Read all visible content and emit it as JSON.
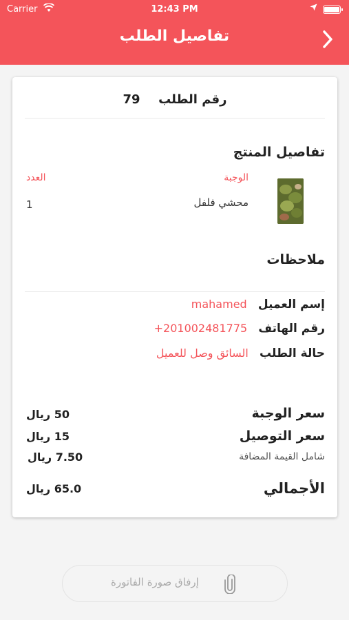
{
  "status_bar": {
    "carrier": "Carrier",
    "time": "12:43 PM"
  },
  "header": {
    "title": "تفاصيل الطلب",
    "back_icon": "chevron-icon",
    "background_color": "#f4545a"
  },
  "order": {
    "number_label": "رقم الطلب",
    "number_value": "79"
  },
  "product_details": {
    "title": "تفاصيل المنتج",
    "col_meal": "الوجبة",
    "col_qty": "العدد",
    "items": [
      {
        "name": "محشي فلفل",
        "qty": "1"
      }
    ]
  },
  "notes": {
    "title": "ملاحظات"
  },
  "customer": {
    "name_label": "إسم العميل",
    "name_value": "mahamed",
    "phone_label": "رقم الهاتف",
    "phone_value": "201002481775+",
    "status_label": "حالة الطلب",
    "status_value": "السائق وصل للعميل"
  },
  "pricing": {
    "meal_label": "سعر الوجبة",
    "meal_value": "50 ريال",
    "delivery_label": "سعر التوصيل",
    "delivery_value": "15 ريال",
    "vat_label": "شامل القيمة المضافة",
    "vat_value": "7.50 ريال",
    "total_label": "الأجمالي",
    "total_value": "65.0 ريال"
  },
  "attach": {
    "label": "إرفاق صورة الفاتورة",
    "icon": "paperclip-icon"
  },
  "colors": {
    "accent": "#f4545a"
  }
}
